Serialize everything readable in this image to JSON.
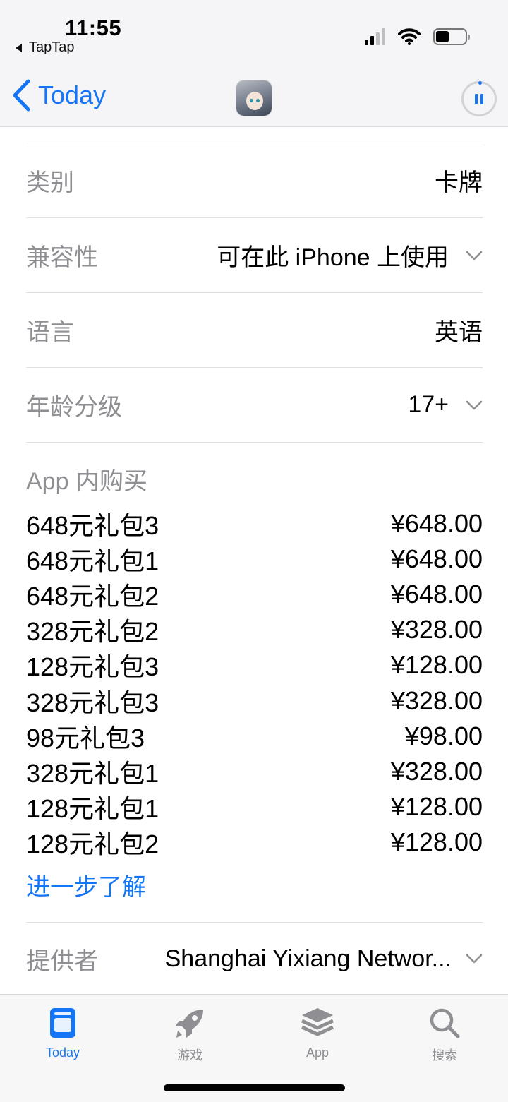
{
  "status_bar": {
    "time": "11:55",
    "back_app": "TapTap"
  },
  "nav": {
    "back_label": "Today"
  },
  "info_rows": [
    {
      "label": "类别",
      "value": "卡牌",
      "expandable": false
    },
    {
      "label": "兼容性",
      "value": "可在此 iPhone 上使用",
      "expandable": true
    },
    {
      "label": "语言",
      "value": "英语",
      "expandable": false
    },
    {
      "label": "年龄分级",
      "value": "17+",
      "expandable": true
    }
  ],
  "in_app_purchases": {
    "title": "App 内购买",
    "items": [
      {
        "name": "648元礼包3",
        "price": "¥648.00"
      },
      {
        "name": "648元礼包1",
        "price": "¥648.00"
      },
      {
        "name": "648元礼包2",
        "price": "¥648.00"
      },
      {
        "name": "328元礼包2",
        "price": "¥328.00"
      },
      {
        "name": "128元礼包3",
        "price": "¥128.00"
      },
      {
        "name": "328元礼包3",
        "price": "¥328.00"
      },
      {
        "name": "98元礼包3",
        "price": "¥98.00"
      },
      {
        "name": "328元礼包1",
        "price": "¥328.00"
      },
      {
        "name": "128元礼包1",
        "price": "¥128.00"
      },
      {
        "name": "128元礼包2",
        "price": "¥128.00"
      }
    ],
    "more_link": "进一步了解"
  },
  "provider": {
    "label": "提供者",
    "value": "Shanghai Yixiang Networ..."
  },
  "tabbar": {
    "tabs": [
      {
        "label": "Today",
        "icon": "today-icon",
        "active": true
      },
      {
        "label": "游戏",
        "icon": "rocket-icon",
        "active": false
      },
      {
        "label": "App",
        "icon": "app-stack-icon",
        "active": false
      },
      {
        "label": "搜索",
        "icon": "search-icon",
        "active": false
      }
    ]
  },
  "colors": {
    "accent": "#1476f6",
    "secondary_text": "#8e8e93",
    "separator": "#e0e0e3"
  }
}
